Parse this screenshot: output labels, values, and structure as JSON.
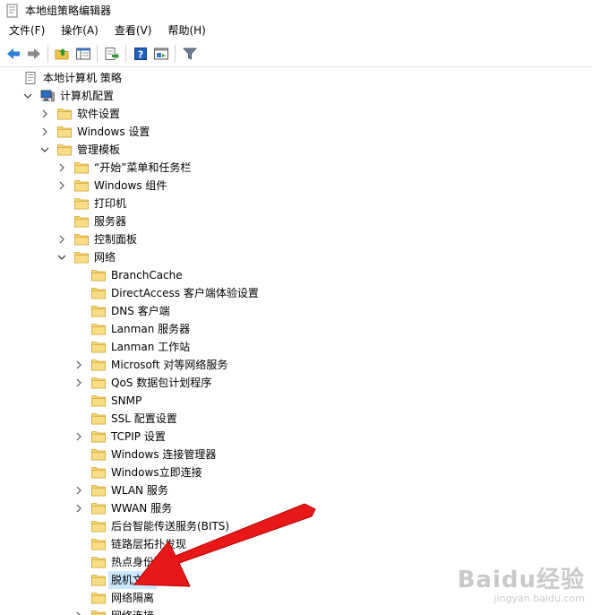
{
  "window": {
    "title": "本地组策略编辑器"
  },
  "menu": [
    "文件(F)",
    "操作(A)",
    "查看(V)",
    "帮助(H)"
  ],
  "toolbar": {
    "buttons": [
      "back-icon",
      "forward-icon",
      "up-folder-icon",
      "show-hide-tree-icon",
      "export-list-icon",
      "help-icon",
      "properties-icon",
      "filter-icon"
    ]
  },
  "tree": [
    {
      "label": "本地计算机 策略",
      "indent": 0,
      "chevron": "none",
      "icon": "policy-icon",
      "name": "tree-item-local-computer-policy"
    },
    {
      "label": "计算机配置",
      "indent": 1,
      "chevron": "down",
      "icon": "computer-icon",
      "name": "tree-item-computer-configuration"
    },
    {
      "label": "软件设置",
      "indent": 2,
      "chevron": "right",
      "icon": "folder-icon",
      "name": "tree-item-software-settings"
    },
    {
      "label": "Windows 设置",
      "indent": 2,
      "chevron": "right",
      "icon": "folder-icon",
      "name": "tree-item-windows-settings"
    },
    {
      "label": "管理模板",
      "indent": 2,
      "chevron": "down",
      "icon": "folder-icon",
      "name": "tree-item-administrative-templates"
    },
    {
      "label": "“开始”菜单和任务栏",
      "indent": 3,
      "chevron": "right",
      "icon": "folder-icon",
      "name": "tree-item-start-menu-taskbar"
    },
    {
      "label": "Windows 组件",
      "indent": 3,
      "chevron": "right",
      "icon": "folder-icon",
      "name": "tree-item-windows-components"
    },
    {
      "label": "打印机",
      "indent": 3,
      "chevron": "none",
      "icon": "folder-icon",
      "name": "tree-item-printers"
    },
    {
      "label": "服务器",
      "indent": 3,
      "chevron": "none",
      "icon": "folder-icon",
      "name": "tree-item-server"
    },
    {
      "label": "控制面板",
      "indent": 3,
      "chevron": "right",
      "icon": "folder-icon",
      "name": "tree-item-control-panel"
    },
    {
      "label": "网络",
      "indent": 3,
      "chevron": "down",
      "icon": "folder-icon",
      "name": "tree-item-network"
    },
    {
      "label": "BranchCache",
      "indent": 4,
      "chevron": "none",
      "icon": "folder-icon",
      "name": "tree-item-branchcache"
    },
    {
      "label": "DirectAccess 客户端体验设置",
      "indent": 4,
      "chevron": "none",
      "icon": "folder-icon",
      "name": "tree-item-directaccess"
    },
    {
      "label": "DNS 客户端",
      "indent": 4,
      "chevron": "none",
      "icon": "folder-icon",
      "name": "tree-item-dns-client"
    },
    {
      "label": "Lanman 服务器",
      "indent": 4,
      "chevron": "none",
      "icon": "folder-icon",
      "name": "tree-item-lanman-server"
    },
    {
      "label": "Lanman 工作站",
      "indent": 4,
      "chevron": "none",
      "icon": "folder-icon",
      "name": "tree-item-lanman-workstation"
    },
    {
      "label": "Microsoft 对等网络服务",
      "indent": 4,
      "chevron": "right",
      "icon": "folder-icon",
      "name": "tree-item-microsoft-peer-networking"
    },
    {
      "label": "QoS 数据包计划程序",
      "indent": 4,
      "chevron": "right",
      "icon": "folder-icon",
      "name": "tree-item-qos"
    },
    {
      "label": "SNMP",
      "indent": 4,
      "chevron": "none",
      "icon": "folder-icon",
      "name": "tree-item-snmp"
    },
    {
      "label": "SSL 配置设置",
      "indent": 4,
      "chevron": "none",
      "icon": "folder-icon",
      "name": "tree-item-ssl"
    },
    {
      "label": "TCPIP 设置",
      "indent": 4,
      "chevron": "right",
      "icon": "folder-icon",
      "name": "tree-item-tcpip"
    },
    {
      "label": "Windows 连接管理器",
      "indent": 4,
      "chevron": "none",
      "icon": "folder-icon",
      "name": "tree-item-windows-connection-manager"
    },
    {
      "label": "Windows立即连接",
      "indent": 4,
      "chevron": "none",
      "icon": "folder-icon",
      "name": "tree-item-windows-connect-now"
    },
    {
      "label": "WLAN 服务",
      "indent": 4,
      "chevron": "right",
      "icon": "folder-icon",
      "name": "tree-item-wlan"
    },
    {
      "label": "WWAN 服务",
      "indent": 4,
      "chevron": "right",
      "icon": "folder-icon",
      "name": "tree-item-wwan"
    },
    {
      "label": "后台智能传送服务(BITS)",
      "indent": 4,
      "chevron": "none",
      "icon": "folder-icon",
      "name": "tree-item-bits"
    },
    {
      "label": "链路层拓扑发现",
      "indent": 4,
      "chevron": "none",
      "icon": "folder-icon",
      "name": "tree-item-link-layer-topology"
    },
    {
      "label": "热点身份验证",
      "indent": 4,
      "chevron": "none",
      "icon": "folder-icon",
      "name": "tree-item-hotspot-auth"
    },
    {
      "label": "脱机文件",
      "indent": 4,
      "chevron": "none",
      "icon": "folder-icon",
      "name": "tree-item-offline-files",
      "selected": true
    },
    {
      "label": "网络隔离",
      "indent": 4,
      "chevron": "none",
      "icon": "folder-icon",
      "name": "tree-item-network-isolation"
    },
    {
      "label": "网络连接",
      "indent": 4,
      "chevron": "right",
      "icon": "folder-icon",
      "name": "tree-item-network-connections"
    }
  ],
  "watermark": {
    "brand": "Baidu经验",
    "url": "jingyan.baidu.com"
  },
  "colors": {
    "selection": "#cce8ff",
    "folder": "#f6d472",
    "arrow": "#e81818"
  }
}
